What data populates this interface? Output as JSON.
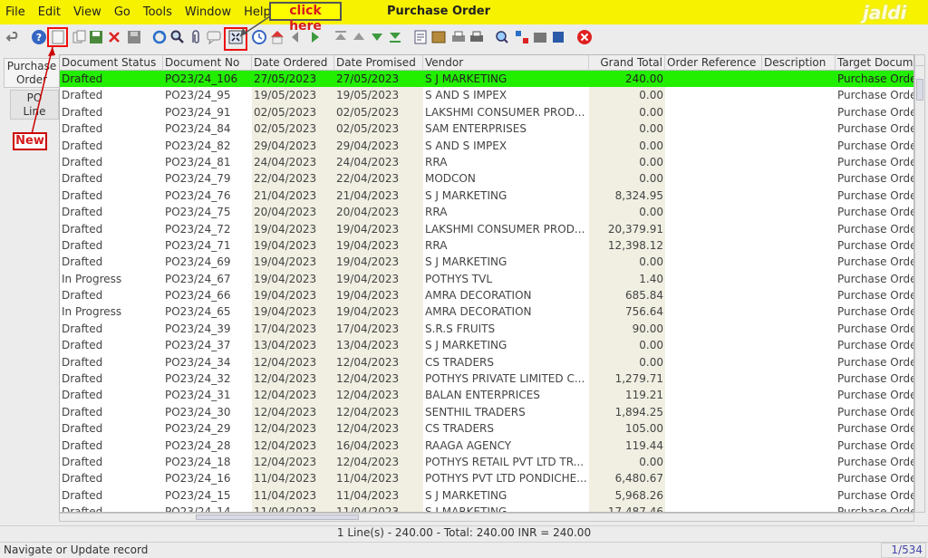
{
  "menu": [
    "File",
    "Edit",
    "View",
    "Go",
    "Tools",
    "Window",
    "Help"
  ],
  "window_title": "Purchase Order",
  "watermark": "jaldi",
  "callouts": {
    "click_here": "click here",
    "new": "New"
  },
  "side_tabs": [
    "Purchase Order",
    "PO Line"
  ],
  "toolbar_icons": [
    "undo-icon",
    "help-icon",
    "new-icon",
    "copy-icon",
    "save-new-icon",
    "delete-icon",
    "save-icon",
    "refresh-icon",
    "find-icon",
    "attachment-icon",
    "chat-icon",
    "toggle-grid-icon",
    "history-icon",
    "home-icon",
    "back-icon",
    "forward-icon",
    "first-record-icon",
    "previous-record-icon",
    "next-record-icon",
    "last-record-icon",
    "report-icon",
    "archive-icon",
    "print-preview-icon",
    "print-icon",
    "zoom-across-icon",
    "request-icon",
    "workflow-icon",
    "product-info-icon",
    "close-window-icon"
  ],
  "columns": [
    "Document Status",
    "Document No",
    "Date Ordered",
    "Date Promised",
    "Vendor",
    "Grand Total",
    "Order Reference",
    "Description",
    "Target Document"
  ],
  "rows": [
    [
      "Drafted",
      "PO23/24_106",
      "27/05/2023",
      "27/05/2023",
      "S J MARKETING",
      "240.00",
      "",
      "",
      "Purchase Order"
    ],
    [
      "Drafted",
      "PO23/24_95",
      "19/05/2023",
      "19/05/2023",
      "S AND S IMPEX",
      "0.00",
      "",
      "",
      "Purchase Order"
    ],
    [
      "Drafted",
      "PO23/24_91",
      "02/05/2023",
      "02/05/2023",
      "LAKSHMI CONSUMER PROD...",
      "0.00",
      "",
      "",
      "Purchase Order"
    ],
    [
      "Drafted",
      "PO23/24_84",
      "02/05/2023",
      "02/05/2023",
      "SAM ENTERPRISES",
      "0.00",
      "",
      "",
      "Purchase Order"
    ],
    [
      "Drafted",
      "PO23/24_82",
      "29/04/2023",
      "29/04/2023",
      "S AND S IMPEX",
      "0.00",
      "",
      "",
      "Purchase Order"
    ],
    [
      "Drafted",
      "PO23/24_81",
      "24/04/2023",
      "24/04/2023",
      "RRA",
      "0.00",
      "",
      "",
      "Purchase Order"
    ],
    [
      "Drafted",
      "PO23/24_79",
      "22/04/2023",
      "22/04/2023",
      "MODCON",
      "0.00",
      "",
      "",
      "Purchase Order"
    ],
    [
      "Drafted",
      "PO23/24_76",
      "21/04/2023",
      "21/04/2023",
      "S J MARKETING",
      "8,324.95",
      "",
      "",
      "Purchase Order"
    ],
    [
      "Drafted",
      "PO23/24_75",
      "20/04/2023",
      "20/04/2023",
      "RRA",
      "0.00",
      "",
      "",
      "Purchase Order"
    ],
    [
      "Drafted",
      "PO23/24_72",
      "19/04/2023",
      "19/04/2023",
      "LAKSHMI CONSUMER PROD...",
      "20,379.91",
      "",
      "",
      "Purchase Order"
    ],
    [
      "Drafted",
      "PO23/24_71",
      "19/04/2023",
      "19/04/2023",
      "RRA",
      "12,398.12",
      "",
      "",
      "Purchase Order"
    ],
    [
      "Drafted",
      "PO23/24_69",
      "19/04/2023",
      "19/04/2023",
      "S J MARKETING",
      "0.00",
      "",
      "",
      "Purchase Order"
    ],
    [
      "In Progress",
      "PO23/24_67",
      "19/04/2023",
      "19/04/2023",
      "POTHYS TVL",
      "1.40",
      "",
      "",
      "Purchase Order"
    ],
    [
      "Drafted",
      "PO23/24_66",
      "19/04/2023",
      "19/04/2023",
      "AMRA DECORATION",
      "685.84",
      "",
      "",
      "Purchase Order"
    ],
    [
      "In Progress",
      "PO23/24_65",
      "19/04/2023",
      "19/04/2023",
      "AMRA DECORATION",
      "756.64",
      "",
      "",
      "Purchase Order"
    ],
    [
      "Drafted",
      "PO23/24_39",
      "17/04/2023",
      "17/04/2023",
      "S.R.S FRUITS",
      "90.00",
      "",
      "",
      "Purchase Order"
    ],
    [
      "Drafted",
      "PO23/24_37",
      "13/04/2023",
      "13/04/2023",
      "S J MARKETING",
      "0.00",
      "",
      "",
      "Purchase Order"
    ],
    [
      "Drafted",
      "PO23/24_34",
      "12/04/2023",
      "12/04/2023",
      "CS TRADERS",
      "0.00",
      "",
      "",
      "Purchase Order"
    ],
    [
      "Drafted",
      "PO23/24_32",
      "12/04/2023",
      "12/04/2023",
      "POTHYS PRIVATE LIMITED C...",
      "1,279.71",
      "",
      "",
      "Purchase Order"
    ],
    [
      "Drafted",
      "PO23/24_31",
      "12/04/2023",
      "12/04/2023",
      "BALAN ENTERPRICES",
      "119.21",
      "",
      "",
      "Purchase Order"
    ],
    [
      "Drafted",
      "PO23/24_30",
      "12/04/2023",
      "12/04/2023",
      "SENTHIL TRADERS",
      "1,894.25",
      "",
      "",
      "Purchase Order"
    ],
    [
      "Drafted",
      "PO23/24_29",
      "12/04/2023",
      "12/04/2023",
      "CS TRADERS",
      "105.00",
      "",
      "",
      "Purchase Order"
    ],
    [
      "Drafted",
      "PO23/24_28",
      "12/04/2023",
      "16/04/2023",
      "RAAGA AGENCY",
      "119.44",
      "",
      "",
      "Purchase Order"
    ],
    [
      "Drafted",
      "PO23/24_18",
      "12/04/2023",
      "12/04/2023",
      "POTHYS RETAIL PVT LTD TR...",
      "0.00",
      "",
      "",
      "Purchase Order"
    ],
    [
      "Drafted",
      "PO23/24_16",
      "11/04/2023",
      "11/04/2023",
      "POTHYS PVT LTD PONDICHE...",
      "6,480.67",
      "",
      "",
      "Purchase Order"
    ],
    [
      "Drafted",
      "PO23/24_15",
      "11/04/2023",
      "11/04/2023",
      "S J MARKETING",
      "5,968.26",
      "",
      "",
      "Purchase Order"
    ],
    [
      "Drafted",
      "PO23/24_14",
      "11/04/2023",
      "11/04/2023",
      "S J MARKETING",
      "17,487.46",
      "",
      "",
      "Purchase Order"
    ]
  ],
  "summary": "1 Line(s) - 240.00 -  Total: 240.00  INR  =  240.00",
  "status_message": "Navigate or Update record",
  "record_counter": "1/534",
  "colors": {
    "menubar": "#f7f200",
    "selected_row": "#22ee00",
    "shaded_col": "#f0efe2"
  }
}
